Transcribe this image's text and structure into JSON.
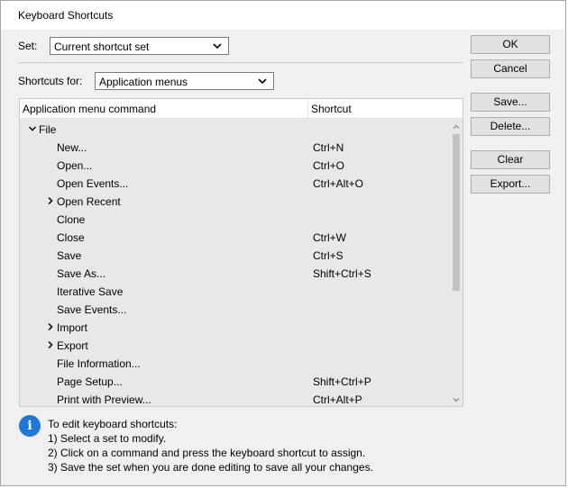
{
  "window": {
    "title": "Keyboard Shortcuts"
  },
  "set": {
    "label": "Set:",
    "value": "Current shortcut set"
  },
  "shortcuts_for": {
    "label": "Shortcuts for:",
    "value": "Application menus"
  },
  "table": {
    "headers": [
      "Application menu command",
      "Shortcut"
    ],
    "rows": [
      {
        "command": "File",
        "shortcut": "",
        "level": 0,
        "toggle": "expanded"
      },
      {
        "command": "New...",
        "shortcut": "Ctrl+N",
        "level": 1,
        "toggle": ""
      },
      {
        "command": "Open...",
        "shortcut": "Ctrl+O",
        "level": 1,
        "toggle": ""
      },
      {
        "command": "Open Events...",
        "shortcut": "Ctrl+Alt+O",
        "level": 1,
        "toggle": ""
      },
      {
        "command": "Open Recent",
        "shortcut": "",
        "level": 1,
        "toggle": "collapsed"
      },
      {
        "command": "Clone",
        "shortcut": "",
        "level": 1,
        "toggle": ""
      },
      {
        "command": "Close",
        "shortcut": "Ctrl+W",
        "level": 1,
        "toggle": ""
      },
      {
        "command": "Save",
        "shortcut": "Ctrl+S",
        "level": 1,
        "toggle": ""
      },
      {
        "command": "Save As...",
        "shortcut": "Shift+Ctrl+S",
        "level": 1,
        "toggle": ""
      },
      {
        "command": "Iterative Save",
        "shortcut": "",
        "level": 1,
        "toggle": ""
      },
      {
        "command": "Save Events...",
        "shortcut": "",
        "level": 1,
        "toggle": ""
      },
      {
        "command": "Import",
        "shortcut": "",
        "level": 1,
        "toggle": "collapsed"
      },
      {
        "command": "Export",
        "shortcut": "",
        "level": 1,
        "toggle": "collapsed"
      },
      {
        "command": "File Information...",
        "shortcut": "",
        "level": 1,
        "toggle": ""
      },
      {
        "command": "Page Setup...",
        "shortcut": "Shift+Ctrl+P",
        "level": 1,
        "toggle": ""
      },
      {
        "command": "Print with Preview...",
        "shortcut": "Ctrl+Alt+P",
        "level": 1,
        "toggle": ""
      }
    ]
  },
  "buttons": {
    "ok": "OK",
    "cancel": "Cancel",
    "save": "Save...",
    "delete": "Delete...",
    "clear": "Clear",
    "export": "Export..."
  },
  "help": {
    "lines": [
      "To edit keyboard shortcuts:",
      "1) Select a set to modify.",
      "2) Click on a command and press the keyboard shortcut to assign.",
      "3) Save the set when you are done editing to save all your changes."
    ]
  },
  "colors": {
    "info_icon": "#1e78d8",
    "dialog_bg": "#f0f0f0",
    "list_bg": "#e8e8e8"
  }
}
